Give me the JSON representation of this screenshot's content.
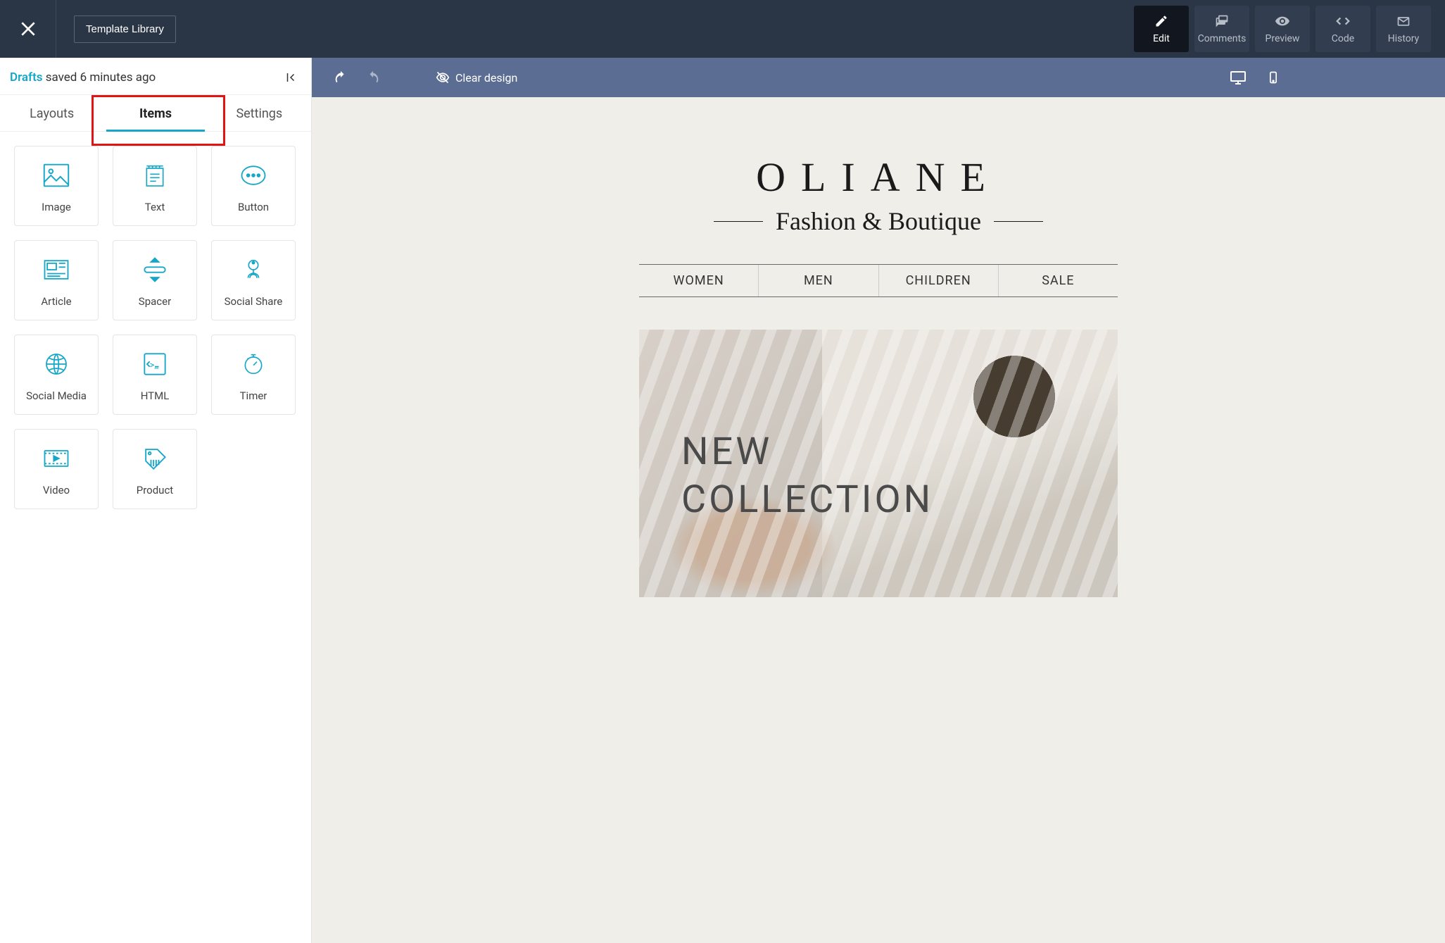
{
  "header": {
    "template_library_label": "Template Library",
    "modes": [
      {
        "key": "edit",
        "label": "Edit",
        "active": true
      },
      {
        "key": "comments",
        "label": "Comments",
        "active": false
      },
      {
        "key": "preview",
        "label": "Preview",
        "active": false
      },
      {
        "key": "code",
        "label": "Code",
        "active": false
      },
      {
        "key": "history",
        "label": "History",
        "active": false
      }
    ]
  },
  "sidebar": {
    "drafts_label": "Drafts",
    "saved_text": " saved 6 minutes ago",
    "tabs": {
      "layouts": "Layouts",
      "items": "Items",
      "settings": "Settings",
      "active": "items"
    },
    "items": [
      {
        "label": "Image",
        "icon": "image-icon"
      },
      {
        "label": "Text",
        "icon": "text-icon"
      },
      {
        "label": "Button",
        "icon": "button-icon"
      },
      {
        "label": "Article",
        "icon": "article-icon"
      },
      {
        "label": "Spacer",
        "icon": "spacer-icon"
      },
      {
        "label": "Social Share",
        "icon": "social-share-icon"
      },
      {
        "label": "Social Media",
        "icon": "social-media-icon"
      },
      {
        "label": "HTML",
        "icon": "html-icon"
      },
      {
        "label": "Timer",
        "icon": "timer-icon"
      },
      {
        "label": "Video",
        "icon": "video-icon"
      },
      {
        "label": "Product",
        "icon": "product-icon"
      }
    ]
  },
  "canvas_toolbar": {
    "clear_design": "Clear design"
  },
  "email": {
    "brand": "OLIANE",
    "tagline": "Fashion & Boutique",
    "nav": [
      "WOMEN",
      "MEN",
      "CHILDREN",
      "SALE"
    ],
    "hero_line1": "NEW",
    "hero_line2": "COLLECTION"
  },
  "colors": {
    "accent": "#16a7c8",
    "topbar": "#2a3646",
    "canvas_toolbar": "#5b6d93",
    "highlight": "#e11414"
  }
}
